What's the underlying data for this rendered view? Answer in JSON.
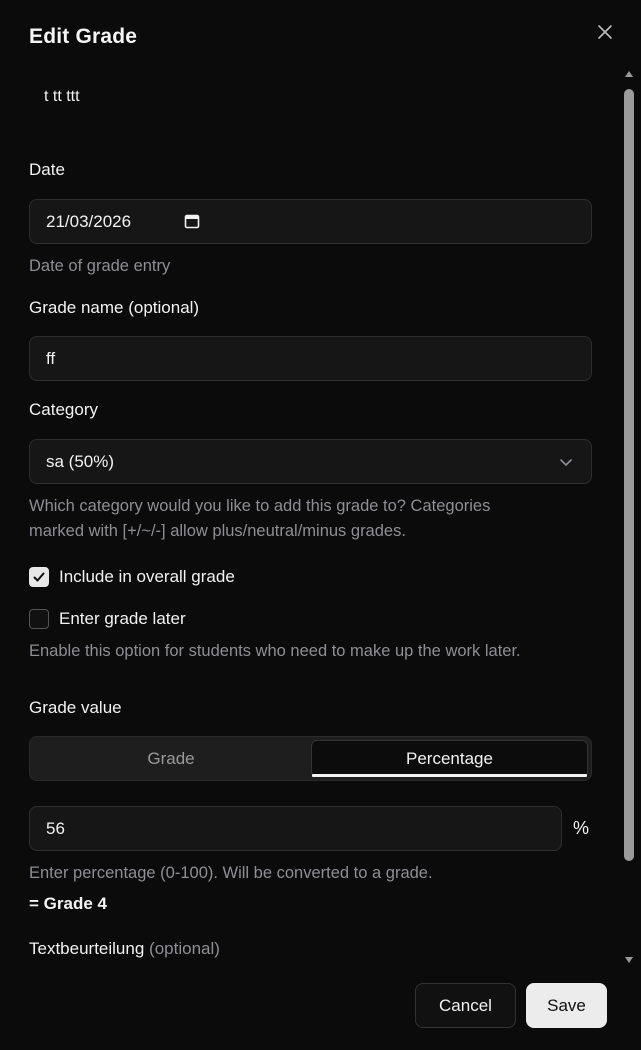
{
  "dialog": {
    "title": "Edit Grade",
    "student": "t tt ttt"
  },
  "date": {
    "label": "Date",
    "value": "21/03/2026",
    "hint": "Date of grade entry"
  },
  "grade_name": {
    "label": "Grade name (optional)",
    "value": "ff"
  },
  "category": {
    "label": "Category",
    "selected": "sa (50%)",
    "hint_line1": "Which category would you like to add this grade to? Categories",
    "hint_line2": "marked with [+/~/-] allow plus/neutral/minus grades."
  },
  "include_overall": {
    "label": "Include in overall grade",
    "checked": true
  },
  "enter_later": {
    "label": "Enter grade later",
    "checked": false,
    "hint": "Enable this option for students who need to make up the work later."
  },
  "grade_value": {
    "label": "Grade value",
    "tabs": [
      "Grade",
      "Percentage"
    ],
    "active_tab": "Percentage",
    "percentage": "56",
    "unit": "%",
    "hint": "Enter percentage (0-100). Will be converted to a grade.",
    "converted": "= Grade 4"
  },
  "text_assessment": {
    "label": "Textbeurteilung",
    "optional": "(optional)"
  },
  "footer": {
    "cancel": "Cancel",
    "save": "Save"
  },
  "icons": {
    "close": "close-icon",
    "calendar": "calendar-icon",
    "chevron": "chevron-down-icon",
    "check": "check-icon"
  }
}
